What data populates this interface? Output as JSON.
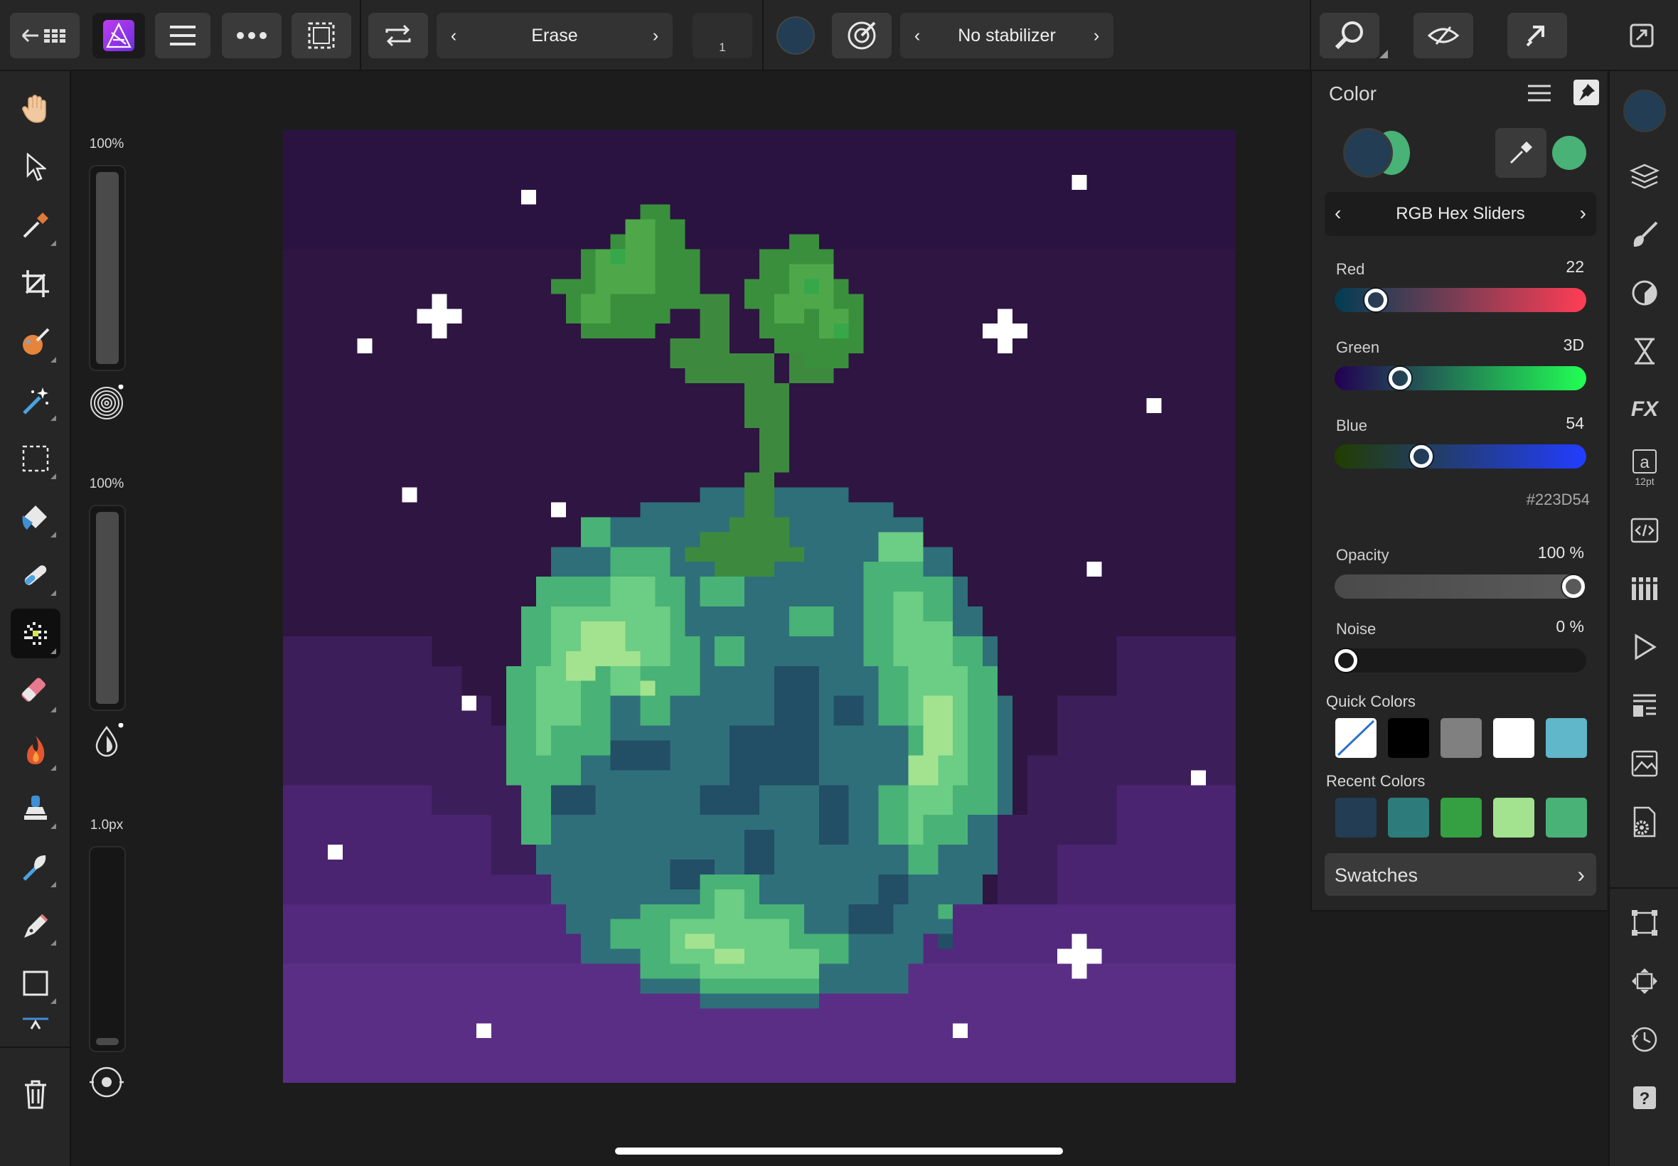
{
  "toolbar": {
    "back_icon": "back-arrow-grid-icon",
    "app_icon": "affinity-photo-logo",
    "menu_icon": "hamburger-icon",
    "more_icon": "ellipsis-icon",
    "selection_icon": "marquee-selection-icon",
    "swap_icon": "swap-arrows-icon",
    "brush_mode": "Erase",
    "brush_width_value": "1",
    "current_color": "#223D54",
    "stabilizer_label": "No stabilizer",
    "right_buttons": [
      "zoom-icon",
      "view-mode-icon",
      "snapping-icon",
      "fullscreen-icon"
    ]
  },
  "left_tools": [
    "hand-icon",
    "move-icon",
    "color-picker-icon",
    "crop-icon",
    "paint-mixer-icon",
    "selection-brush-icon",
    "marquee-icon",
    "flood-fill-icon",
    "smudge-icon",
    "pixel-brush-icon",
    "eraser-icon",
    "burn-icon",
    "clone-icon",
    "dodge-icon",
    "pen-icon",
    "rectangle-icon",
    "more-tools-icon",
    "trash-icon"
  ],
  "brush_controls": {
    "width_percent_label": "100%",
    "opacity_percent_label": "100%",
    "size_label": "1.0px"
  },
  "color_panel": {
    "title": "Color",
    "primary_color": "#223D54",
    "secondary_color": "#49B276",
    "mode_label": "RGB Hex Sliders",
    "red_label": "Red",
    "red_value": "22",
    "green_label": "Green",
    "green_value": "3D",
    "blue_label": "Blue",
    "blue_value": "54",
    "hex_value": "#223D54",
    "opacity_label": "Opacity",
    "opacity_value": "100 %",
    "noise_label": "Noise",
    "noise_value": "0 %",
    "quick_colors_label": "Quick Colors",
    "quick_colors": [
      "none",
      "#000000",
      "#808080",
      "#FFFFFF",
      "#5FB7C9"
    ],
    "recent_colors_label": "Recent Colors",
    "recent_colors": [
      "#223D54",
      "#2E7B7C",
      "#34A041",
      "#A3E38F",
      "#49B276"
    ],
    "swatches_label": "Swatches"
  },
  "right_strip": [
    "color-icon",
    "layers-icon",
    "brushes-icon",
    "adjustments-icon",
    "navigator-icon",
    "fx-icon",
    "text-styles-icon",
    "macro-icon",
    "channels-icon",
    "play-icon",
    "history-list-icon",
    "stock-icon",
    "settings-icon",
    "transform-icon",
    "move-icon",
    "history-icon",
    "help-icon"
  ],
  "text_styles_size": "12pt"
}
